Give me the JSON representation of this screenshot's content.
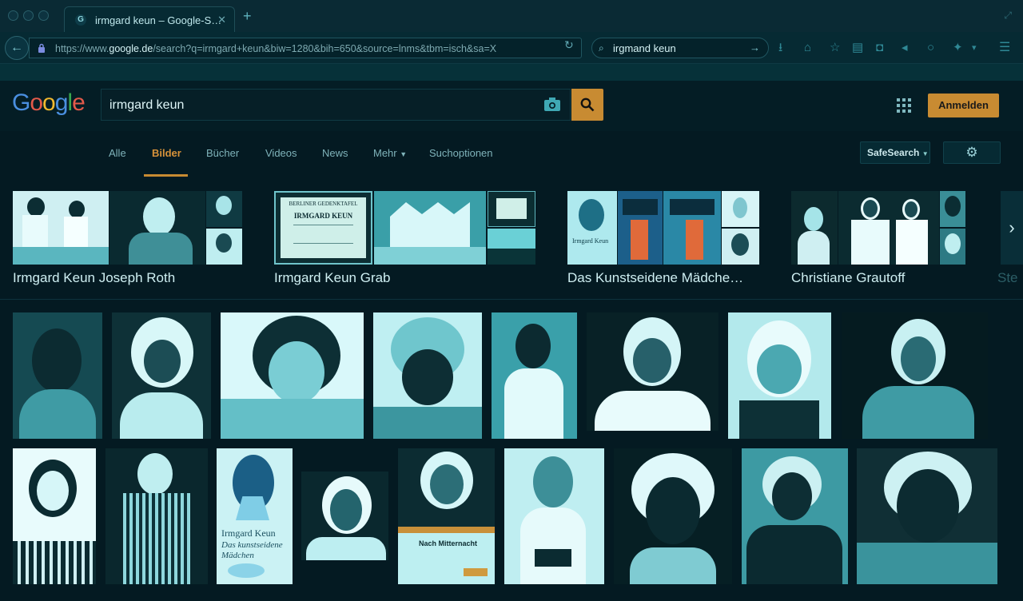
{
  "browser": {
    "tab_title": "irmgard keun – Google-S…",
    "url_prefix": "https://www.",
    "url_host": "google.de",
    "url_rest": "/search?q=irmgard+keun&biw=1280&bih=650&source=lnms&tbm=isch&sa=X",
    "search_value": "irgmand keun"
  },
  "google": {
    "logo": "Google",
    "query": "irmgard keun",
    "login_label": "Anmelden",
    "tabs": [
      "Alle",
      "Bilder",
      "Bücher",
      "Videos",
      "News",
      "Mehr",
      "Suchoptionen"
    ],
    "safesearch_label": "SafeSearch"
  },
  "related": [
    {
      "label": "Irmgard Keun Joseph Roth"
    },
    {
      "label": "Irmgard Keun Grab"
    },
    {
      "label": "Das Kunstseidene Mädche…"
    },
    {
      "label": "Christiane Grautoff"
    },
    {
      "label": "Ste"
    }
  ],
  "book_texts": {
    "plaque_line1": "BERLINER GEDENKTAFEL",
    "plaque_line2": "IRMGARD KEUN",
    "book1_author": "Irmgard Keun",
    "book1_title": "Das kunstseidene Mädchen",
    "book2_title": "Nach Mitternacht"
  },
  "colors": {
    "accent": "#c88b32",
    "background": "#041a22",
    "image_tone": "#7fd9dc"
  }
}
